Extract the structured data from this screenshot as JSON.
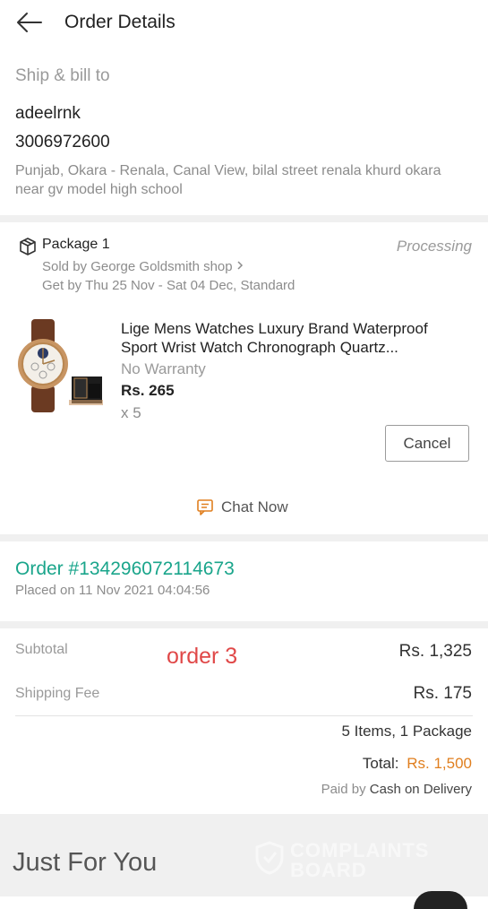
{
  "header": {
    "title": "Order Details"
  },
  "shipping": {
    "heading": "Ship & bill to",
    "name": "adeelrnk",
    "phone": "3006972600",
    "address": "Punjab, Okara - Renala, Canal View, bilal street renala khurd okara near gv model high school"
  },
  "package": {
    "title": "Package 1",
    "status": "Processing",
    "seller": "Sold by George Goldsmith shop",
    "delivery": "Get by Thu 25 Nov - Sat 04 Dec, Standard",
    "product": {
      "name": "Lige Mens Watches Luxury Brand Waterproof Sport Wrist Watch Chronograph Quartz...",
      "warranty": "No Warranty",
      "price": "Rs. 265",
      "quantity": "x 5"
    },
    "cancel_label": "Cancel",
    "chat_label": "Chat Now"
  },
  "order": {
    "number": "Order #134296072114673",
    "placed": "Placed on 11 Nov 2021  04:04:56"
  },
  "summary": {
    "subtotal_label": "Subtotal",
    "subtotal_value": "Rs. 1,325",
    "shipping_label": "Shipping Fee",
    "shipping_value": "Rs. 175",
    "items_packages": "5 Items, 1 Package",
    "total_label": "Total:",
    "total_value": "Rs. 1,500",
    "paid_by_label": "Paid by",
    "paid_by_method": "Cash on Delivery",
    "annotation": "order 3"
  },
  "just_for_you": {
    "title": "Just For You"
  },
  "watermark": {
    "line1": "COMPLAINTS",
    "line2": "BOARD"
  },
  "colors": {
    "accent_green": "#1aa58b",
    "total_orange": "#e07f1f",
    "annotation_red": "#e04848"
  },
  "icons": {
    "back": "arrow-left-icon",
    "package": "package-box-icon",
    "seller_chevron": "chevron-right-icon",
    "chat": "chat-icon"
  }
}
